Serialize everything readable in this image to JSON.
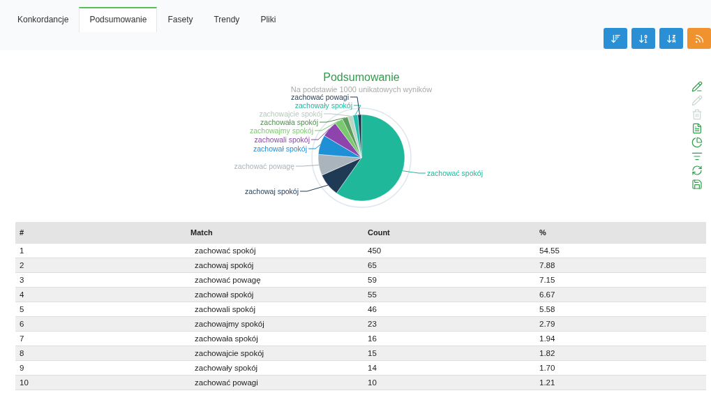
{
  "tabs": [
    {
      "label": "Konkordancje",
      "selected": false
    },
    {
      "label": "Podsumowanie",
      "selected": true
    },
    {
      "label": "Fasety",
      "selected": false
    },
    {
      "label": "Trendy",
      "selected": false
    },
    {
      "label": "Pliki",
      "selected": false
    }
  ],
  "action_buttons": [
    {
      "kind": "sort-frequency"
    },
    {
      "kind": "sort-numeric"
    },
    {
      "kind": "sort-alpha"
    },
    {
      "kind": "feed"
    }
  ],
  "summary": {
    "chart_data": {
      "type": "pie",
      "title": "Podsumowanie",
      "subtitle": "Na podstawie 1000 unikatowych wyników",
      "categories": [
        "zachować spokój",
        "zachowaj spokój",
        "zachować powagę",
        "zachował spokój",
        "zachowali spokój",
        "zachowajmy spokój",
        "zachowała spokój",
        "zachowajcie spokój",
        "zachowały spokój",
        "zachować powagi"
      ],
      "values": [
        59.77,
        8.63,
        7.84,
        7.3,
        6.11,
        3.05,
        2.12,
        1.99,
        1.86,
        1.33
      ]
    }
  },
  "side_tools": [
    {
      "kind": "add-edit",
      "disabled": false
    },
    {
      "kind": "edit",
      "disabled": true
    },
    {
      "kind": "delete",
      "disabled": true
    },
    {
      "kind": "document",
      "disabled": false
    },
    {
      "kind": "pie",
      "disabled": false
    },
    {
      "kind": "filter",
      "disabled": false
    },
    {
      "kind": "refresh",
      "disabled": false
    },
    {
      "kind": "save",
      "disabled": false
    }
  ],
  "table": {
    "columns": [
      "#",
      "Match",
      "Count",
      "%"
    ],
    "rows": [
      [
        "1",
        "zachować spokój",
        "450",
        "54.55"
      ],
      [
        "2",
        "zachowaj spokój",
        "65",
        "7.88"
      ],
      [
        "3",
        "zachować powagę",
        "59",
        "7.15"
      ],
      [
        "4",
        "zachował spokój",
        "55",
        "6.67"
      ],
      [
        "5",
        "zachowali spokój",
        "46",
        "5.58"
      ],
      [
        "6",
        "zachowajmy spokój",
        "23",
        "2.79"
      ],
      [
        "7",
        "zachowała spokój",
        "16",
        "1.94"
      ],
      [
        "8",
        "zachowajcie spokój",
        "15",
        "1.82"
      ],
      [
        "9",
        "zachowały spokój",
        "14",
        "1.70"
      ],
      [
        "10",
        "zachować powagi",
        "10",
        "1.21"
      ]
    ]
  }
}
